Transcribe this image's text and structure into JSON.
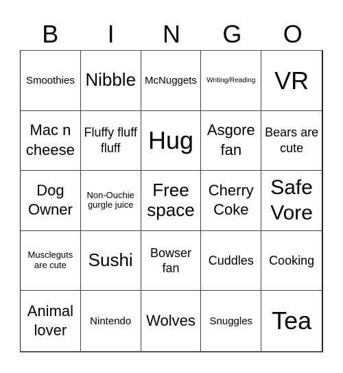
{
  "header": {
    "letters": [
      "B",
      "I",
      "N",
      "G",
      "O"
    ]
  },
  "cells": [
    {
      "text": "Smoothies",
      "size": "fs-sm"
    },
    {
      "text": "Nibble",
      "size": "fs-l"
    },
    {
      "text": "McNuggets",
      "size": "fs-sm"
    },
    {
      "text": "Writing/Reading",
      "size": "fs-xs"
    },
    {
      "text": "VR",
      "size": "fs-xxl"
    },
    {
      "text": "Mac n cheese",
      "size": "fs-ml"
    },
    {
      "text": "Fluffy fluff fluff",
      "size": "fs-m"
    },
    {
      "text": "Hug",
      "size": "fs-xxl"
    },
    {
      "text": "Asgore fan",
      "size": "fs-ml"
    },
    {
      "text": "Bears are cute",
      "size": "fs-m"
    },
    {
      "text": "Dog Owner",
      "size": "fs-ml"
    },
    {
      "text": "Non-Ouchie gurgle juice",
      "size": "fs-s"
    },
    {
      "text": "Free space",
      "size": "fs-l"
    },
    {
      "text": "Cherry Coke",
      "size": "fs-ml"
    },
    {
      "text": "Safe Vore",
      "size": "fs-xl"
    },
    {
      "text": "Muscleguts are cute",
      "size": "fs-s"
    },
    {
      "text": "Sushi",
      "size": "fs-l"
    },
    {
      "text": "Bowser fan",
      "size": "fs-m"
    },
    {
      "text": "Cuddles",
      "size": "fs-m"
    },
    {
      "text": "Cooking",
      "size": "fs-m"
    },
    {
      "text": "Animal lover",
      "size": "fs-ml"
    },
    {
      "text": "Nintendo",
      "size": "fs-sm"
    },
    {
      "text": "Wolves",
      "size": "fs-ml"
    },
    {
      "text": "Snuggles",
      "size": "fs-sm"
    },
    {
      "text": "Tea",
      "size": "fs-xxl"
    }
  ]
}
